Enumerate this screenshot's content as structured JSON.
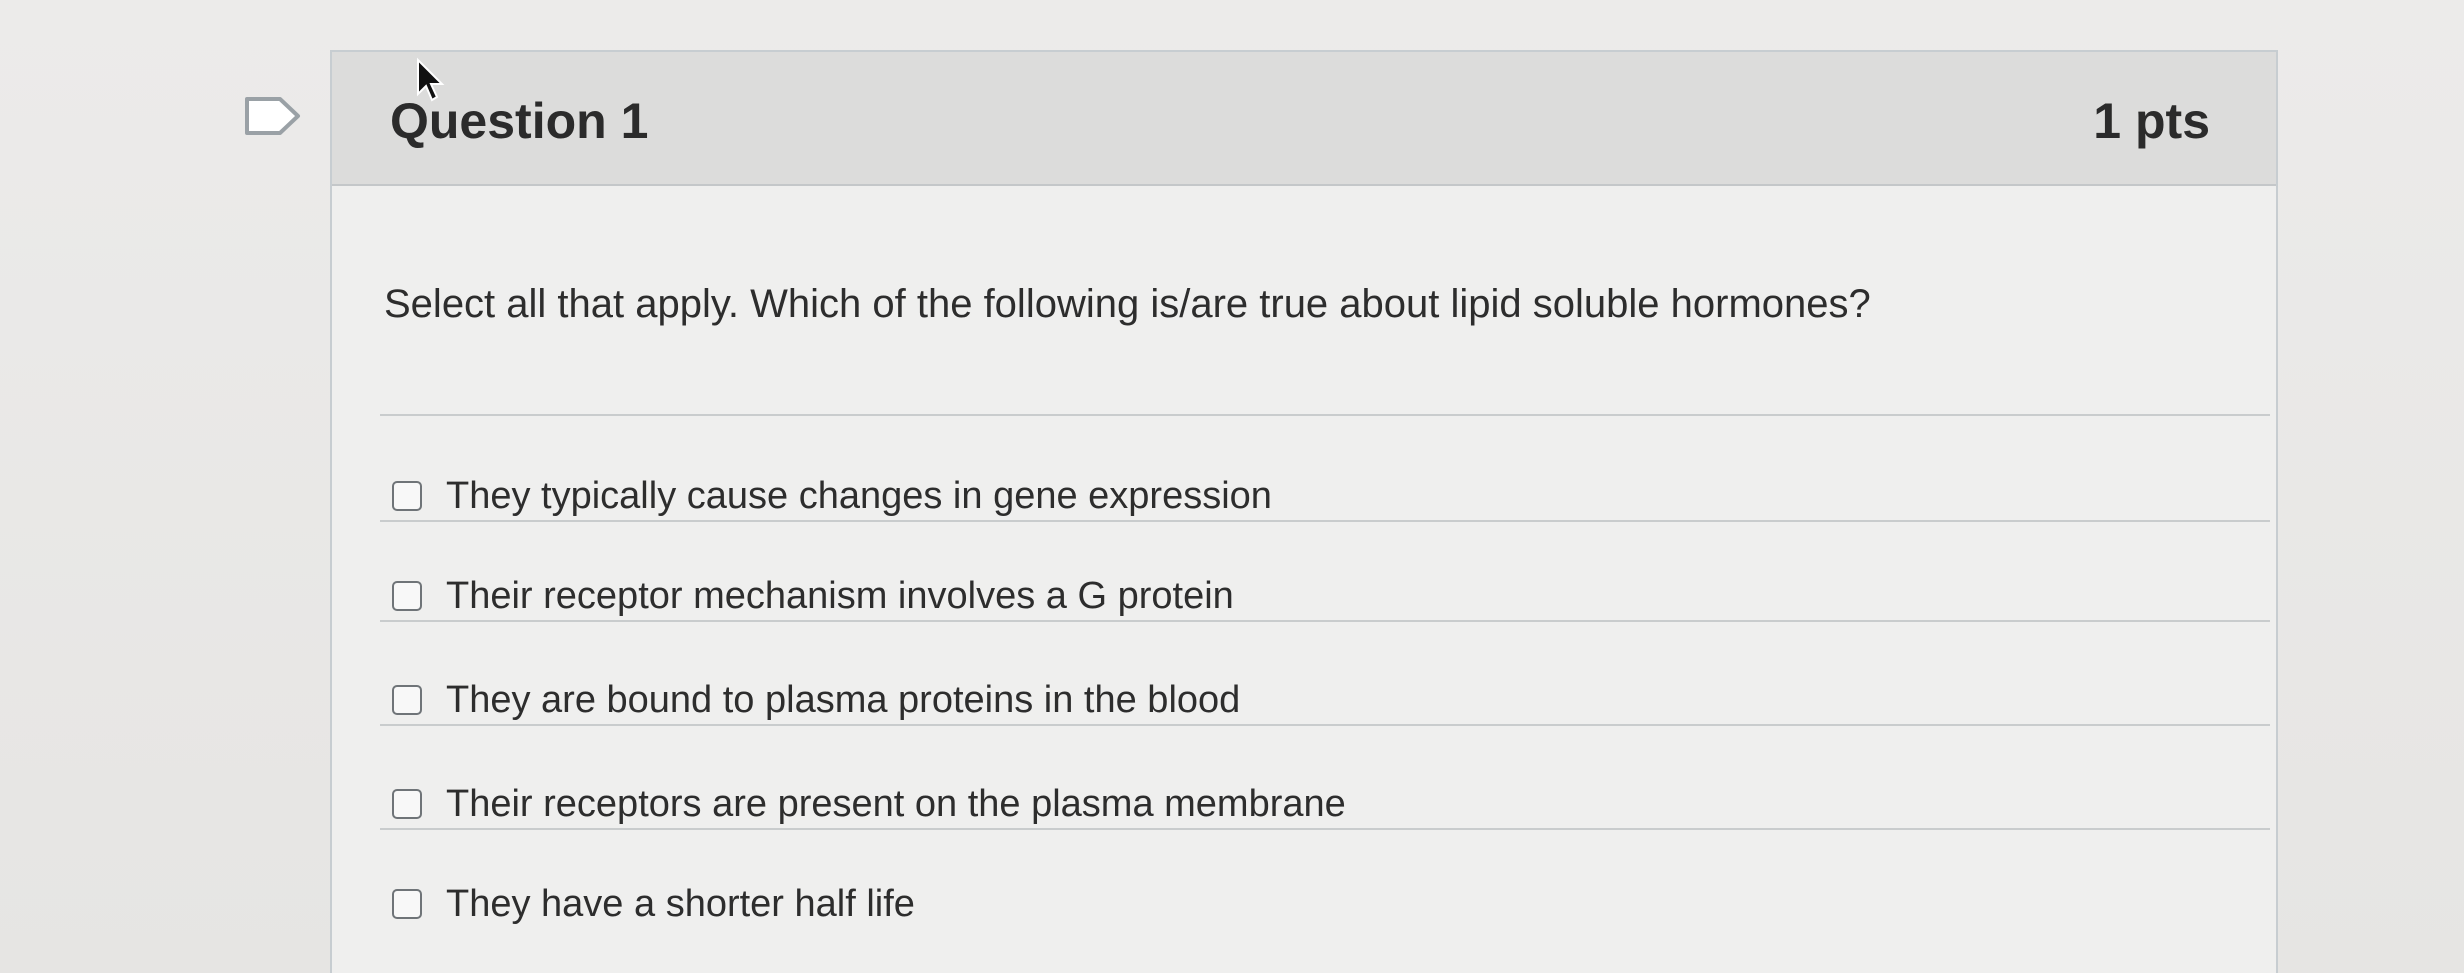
{
  "question": {
    "title": "Question 1",
    "points": "1 pts",
    "prompt": "Select all that apply.  Which of the following is/are true about lipid soluble hormones?"
  },
  "answers": [
    {
      "label": "They typically cause changes in gene expression",
      "checked": false
    },
    {
      "label": "Their receptor mechanism involves a G protein",
      "checked": false
    },
    {
      "label": "They are bound to plasma proteins in the blood",
      "checked": false
    },
    {
      "label": "Their receptors are present on the plasma membrane",
      "checked": false
    },
    {
      "label": "They have a shorter half life",
      "checked": false
    }
  ],
  "icons": {
    "flag": "flag-icon",
    "cursor": "mouse-cursor-icon",
    "checkbox": "checkbox-icon"
  },
  "colors": {
    "header_background": "#dcdcdb",
    "card_background": "#efefee",
    "border": "#c7cdd1",
    "text": "#2d2d2d"
  }
}
